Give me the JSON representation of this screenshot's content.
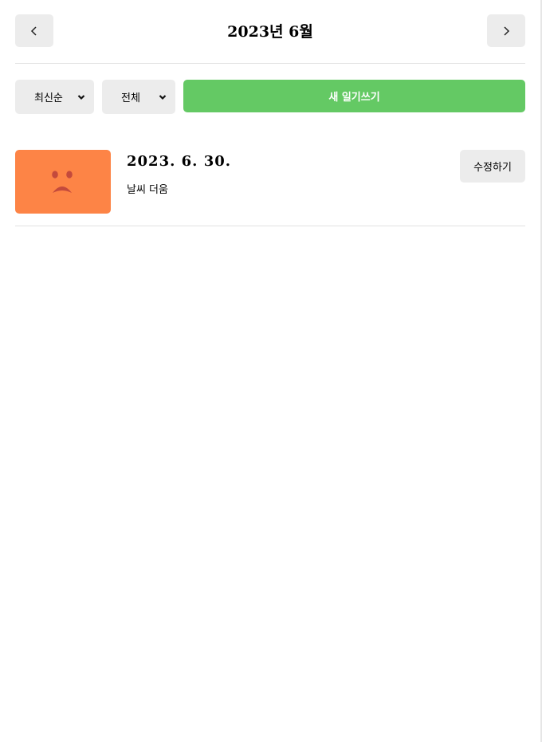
{
  "header": {
    "title": "2023년 6월",
    "prev_icon": "chevron-left-icon",
    "next_icon": "chevron-right-icon"
  },
  "controls": {
    "sort_value": "최신순",
    "filter_value": "전체",
    "new_button_label": "새 일기쓰기",
    "accent_color": "#64c964"
  },
  "diary_list": [
    {
      "date": "2023. 6. 30.",
      "content": "날씨 더움",
      "edit_label": "수정하기",
      "emotion_icon": "sad-face-icon",
      "emotion_color": "#fd8446"
    }
  ]
}
